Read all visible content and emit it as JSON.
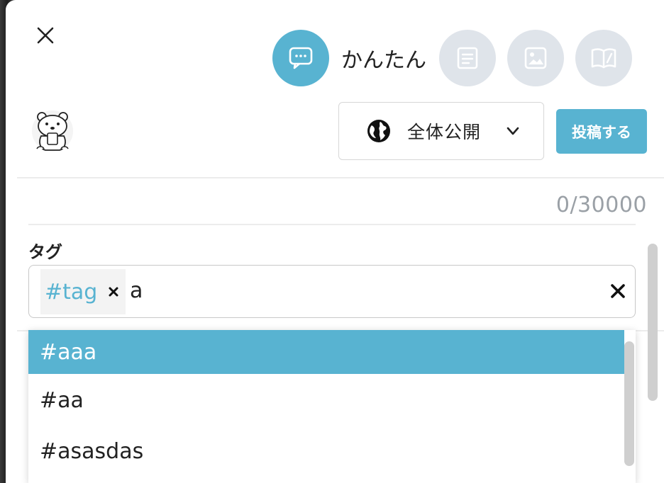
{
  "header": {
    "modes": [
      {
        "icon": "chat-bubble-icon",
        "label": "かんたん",
        "active": true
      },
      {
        "icon": "document-icon",
        "active": false
      },
      {
        "icon": "image-icon",
        "active": false
      },
      {
        "icon": "book-icon",
        "active": false
      }
    ]
  },
  "toolbar": {
    "visibility_label": "全体公開",
    "post_label": "投稿する"
  },
  "editor": {
    "char_counter": "0/30000"
  },
  "tags": {
    "heading": "タグ",
    "chips": [
      "#tag"
    ],
    "typed_value": "a"
  },
  "suggestions": {
    "items": [
      "#aaa",
      "#aa",
      "#asasdas"
    ],
    "selected_index": 0
  },
  "colors": {
    "accent": "#58b3d1",
    "inactive_mode": "#dfe4ea",
    "counter_text": "#9aa0a6"
  }
}
